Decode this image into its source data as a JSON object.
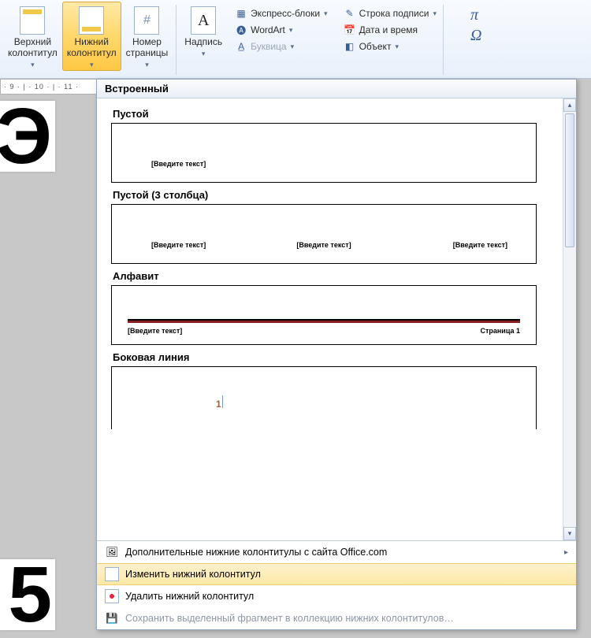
{
  "ribbon": {
    "header_btn": "Верхний\nколонтитул",
    "footer_btn": "Нижний\nколонтитул",
    "page_number_btn": "Номер\nстраницы",
    "textbox_btn": "Надпись",
    "quick_parts": "Экспресс-блоки",
    "wordart": "WordArt",
    "drop_cap": "Буквица",
    "signature_line": "Строка подписи",
    "date_time": "Дата и время",
    "object": "Объект"
  },
  "ruler_text": "· 9 · | · 10 · | · 11 ·",
  "page_fragment_1": "Э",
  "page_fragment_2": "5",
  "gallery": {
    "header": "Встроенный",
    "items": [
      {
        "title": "Пустой",
        "ph": [
          "[Введите текст]"
        ]
      },
      {
        "title": "Пустой (3 столбца)",
        "ph": [
          "[Введите текст]",
          "[Введите текст]",
          "[Введите текст]"
        ]
      },
      {
        "title": "Алфавит",
        "ph": [
          "[Введите текст]",
          "Страница 1"
        ]
      },
      {
        "title": "Боковая линия",
        "ph": [
          "1"
        ]
      }
    ],
    "footer": {
      "more": "Дополнительные нижние колонтитулы с сайта Office.com",
      "edit": "Изменить нижний колонтитул",
      "remove": "Удалить нижний колонтитул",
      "save": "Сохранить выделенный фрагмент в коллекцию нижних колонтитулов…"
    }
  }
}
